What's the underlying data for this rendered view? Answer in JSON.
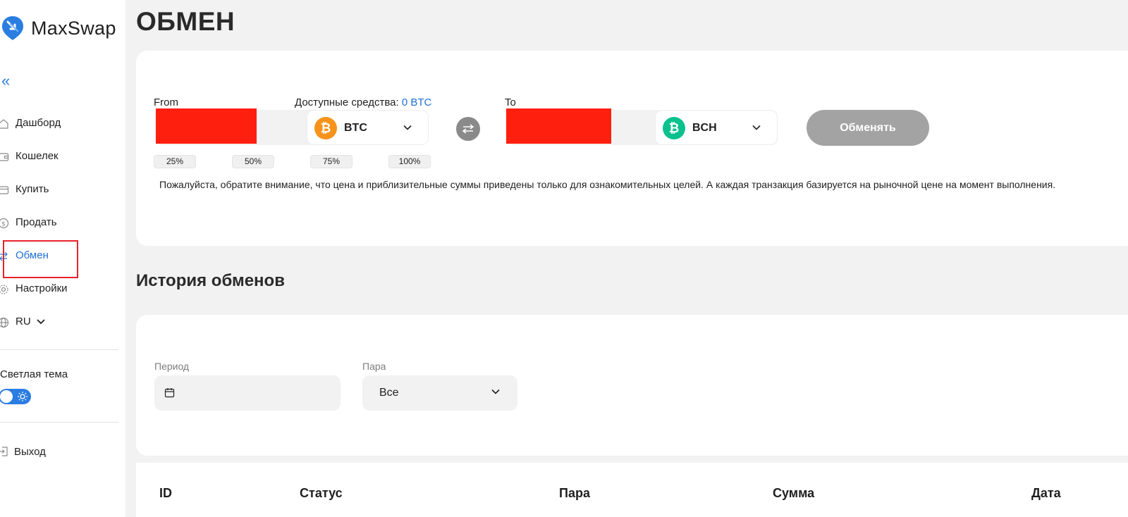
{
  "brand": {
    "name": "MaxSwap",
    "logo_icon": "maxswap-logo-icon"
  },
  "sidebar": {
    "items": [
      {
        "label": "Дашборд",
        "icon": "home-icon"
      },
      {
        "label": "Кошелек",
        "icon": "wallet-icon"
      },
      {
        "label": "Купить",
        "icon": "card-icon"
      },
      {
        "label": "Продать",
        "icon": "dollar-icon"
      },
      {
        "label": "Обмен",
        "icon": "exchange-icon",
        "active": true
      },
      {
        "label": "Настройки",
        "icon": "gear-icon"
      },
      {
        "label": "RU",
        "icon": "globe-icon"
      }
    ],
    "theme_label": "Светлая тема",
    "logout_label": "Выход"
  },
  "page": {
    "title": "ОБМЕН"
  },
  "exchange": {
    "from_label": "From",
    "available_label": "Доступные средства:",
    "available_value": "0 BTC",
    "from_coin": "BTC",
    "to_label": "To",
    "to_coin": "BCH",
    "percent_buttons": [
      "25%",
      "50%",
      "75%",
      "100%"
    ],
    "submit_label": "Обменять",
    "notice": "Пожалуйста, обратите внимание, что цена и приблизительные суммы приведены только для ознакомительных целей. А каждая транзакция базируется на рыночной цене на момент выполнения."
  },
  "history": {
    "title": "История обменов",
    "period_label": "Период",
    "pair_label": "Пара",
    "pair_value": "Все",
    "columns": [
      "ID",
      "Статус",
      "Пара",
      "Сумма",
      "Дата"
    ]
  },
  "colors": {
    "accent": "#2a7de1",
    "btc": "#f7931a",
    "bch": "#0ac18e",
    "redaction": "#ff1f0f"
  }
}
